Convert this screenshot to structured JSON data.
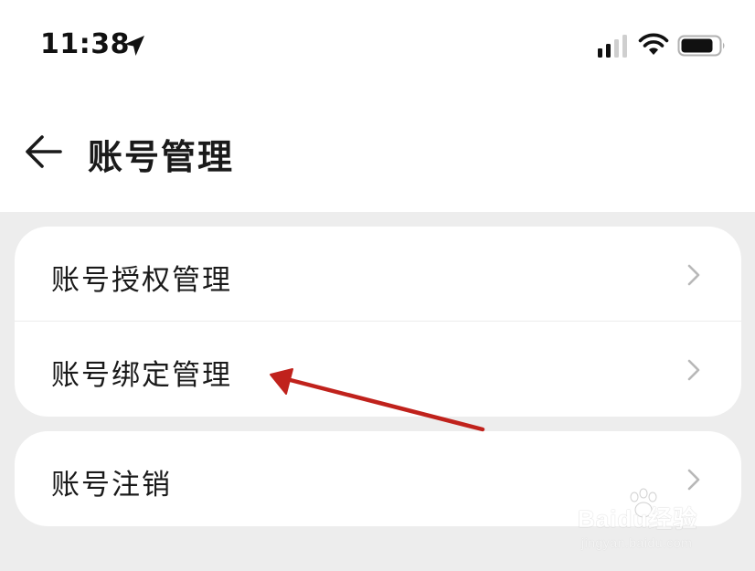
{
  "status_bar": {
    "time": "11:38",
    "icons": [
      "location-arrow-icon",
      "cellular-signal-icon",
      "wifi-icon",
      "battery-icon"
    ]
  },
  "nav": {
    "title": "账号管理",
    "back_icon": "back-arrow-icon"
  },
  "menu_groups": [
    {
      "items": [
        {
          "label": "账号授权管理",
          "icon": "chevron-right-icon"
        },
        {
          "label": "账号绑定管理",
          "icon": "chevron-right-icon"
        }
      ]
    },
    {
      "items": [
        {
          "label": "账号注销",
          "icon": "chevron-right-icon"
        }
      ]
    }
  ],
  "annotation": {
    "color": "#c0221c"
  },
  "watermark": {
    "main": "Baidu经验",
    "sub": "jingyan.baidu.com"
  },
  "colors": {
    "background": "#ededed",
    "card": "#ffffff",
    "text": "#1a1a1a",
    "chevron": "#b8b8b8"
  }
}
